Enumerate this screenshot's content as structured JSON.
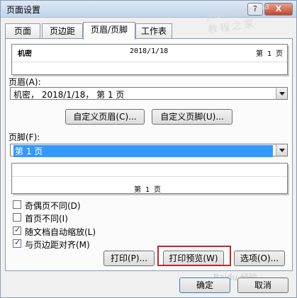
{
  "window": {
    "title": "页面设置",
    "help_label": "?",
    "close_label": "X"
  },
  "tabs": [
    {
      "label": "页面",
      "active": false
    },
    {
      "label": "页边距",
      "active": false
    },
    {
      "label": "页眉/页脚",
      "active": true
    },
    {
      "label": "工作表",
      "active": false
    }
  ],
  "header_preview": {
    "left": "机密",
    "center": "2018/1/18",
    "right": "第 1 页"
  },
  "header": {
    "label": "页眉(A):",
    "value": "机密， 2018/1/18， 第 1 页"
  },
  "buttons": {
    "custom_header": "自定义页眉(C)...",
    "custom_footer": "自定义页脚(U)...",
    "print": "打印(P)...",
    "print_preview": "打印预览(W)",
    "options": "选项(O)...",
    "ok": "确定",
    "cancel": "取消"
  },
  "footer": {
    "label": "页脚(F):",
    "value": "第 1 页"
  },
  "footer_preview": {
    "center": "第 1 页"
  },
  "checkboxes": [
    {
      "label": "奇偶页不同(D)",
      "checked": false
    },
    {
      "label": "首页不同(I)",
      "checked": false
    },
    {
      "label": "随文档自动缩放(L)",
      "checked": true
    },
    {
      "label": "与页边距对齐(M)",
      "checked": true
    }
  ],
  "watermarks": {
    "site": "jiaochengzhijia",
    "site_cn": "教程之家",
    "baidu": "Baidu 经验"
  },
  "colors": {
    "highlight": "#c0282d",
    "selection": "#3399ff"
  }
}
